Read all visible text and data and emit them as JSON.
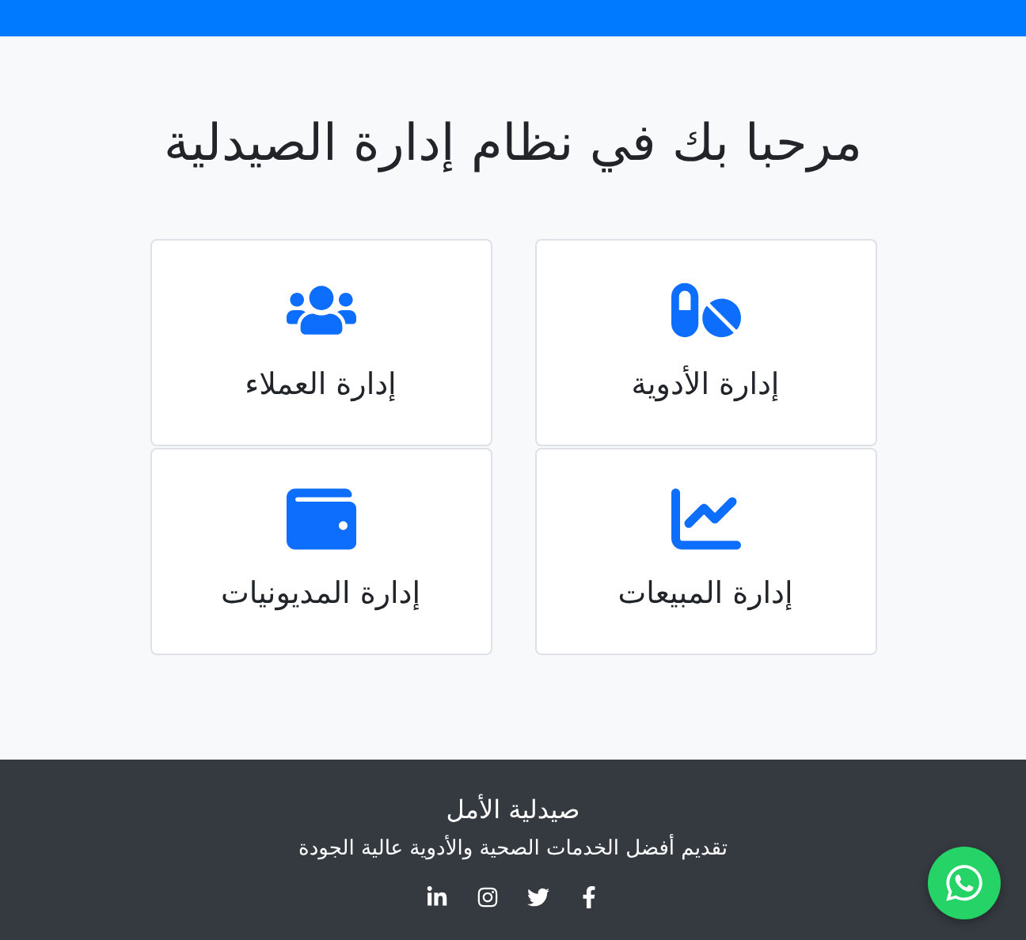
{
  "title": "مرحبا بك في نظام إدارة الصيدلية",
  "cards": [
    {
      "kind": "pills",
      "label": "إدارة الأدوية"
    },
    {
      "kind": "users",
      "label": "إدارة العملاء"
    },
    {
      "kind": "chart",
      "label": "إدارة المبيعات"
    },
    {
      "kind": "wallet",
      "label": "إدارة المديونيات"
    }
  ],
  "footer": {
    "name": "صيدلية الأمل",
    "tagline": "تقديم أفضل الخدمات الصحية والأدوية عالية الجودة",
    "social": [
      {
        "kind": "facebook"
      },
      {
        "kind": "twitter"
      },
      {
        "kind": "instagram"
      },
      {
        "kind": "linkedin"
      }
    ]
  },
  "chat_button": {
    "kind": "whatsapp"
  }
}
